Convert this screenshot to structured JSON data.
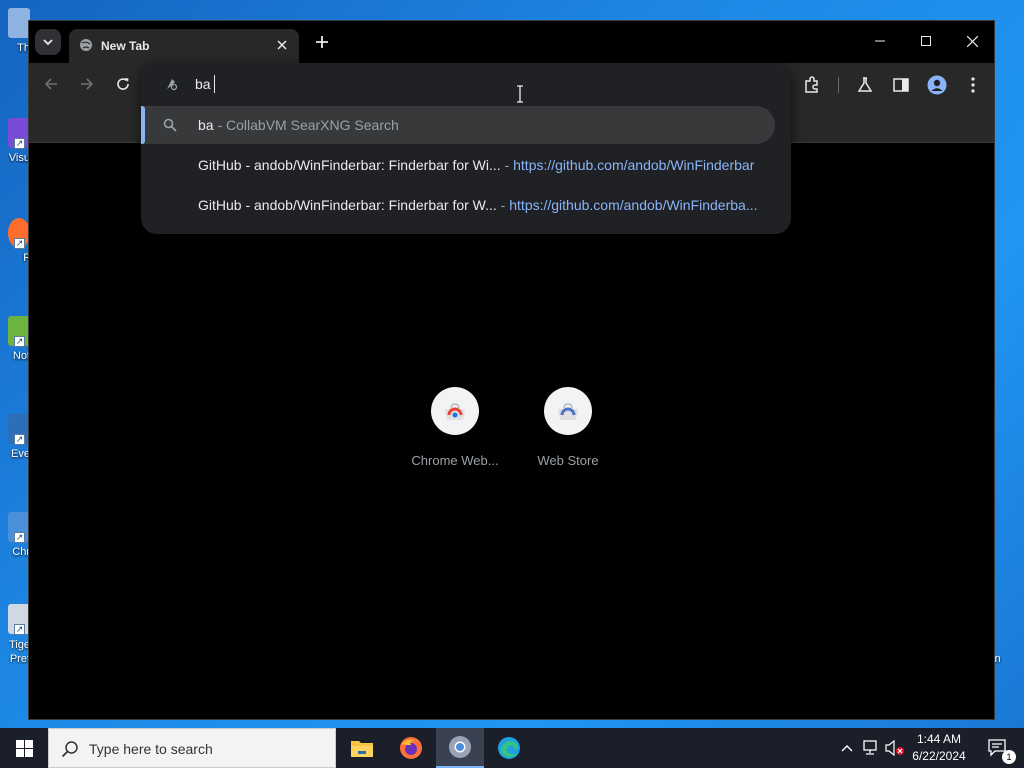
{
  "desktop": {
    "icons": [
      {
        "label": "Th",
        "color": "#8fb3e0"
      },
      {
        "label": "Visu",
        "color": "#7a4bd6"
      },
      {
        "label": "F",
        "color": "#ff6d2a"
      },
      {
        "label": "Not",
        "color": "#6db33f"
      },
      {
        "label": "Eve",
        "color": "#2c6fb7"
      },
      {
        "label": "Chr",
        "color": "#4a8fd9"
      },
      {
        "label": "Tige Pref",
        "color": "#cfd8e3"
      }
    ],
    "right_label": "in"
  },
  "browser": {
    "tab": {
      "title": "New Tab"
    },
    "omnibox": {
      "value": "ba",
      "suggestions": [
        {
          "title": "ba",
          "separator": " - ",
          "detail": "CollabVM SearXNG Search",
          "type": "search"
        },
        {
          "title": "GitHub - andob/WinFinderbar: Finderbar for Wi...",
          "separator": " - ",
          "detail": "https://github.com/andob/WinFinderbar",
          "type": "history"
        },
        {
          "title": "GitHub - andob/WinFinderbar: Finderbar for W...",
          "separator": " - ",
          "detail": "https://github.com/andob/WinFinderba...",
          "type": "history"
        }
      ]
    },
    "shortcuts": [
      {
        "label": "Chrome Web..."
      },
      {
        "label": "Web Store"
      }
    ]
  },
  "taskbar": {
    "search_placeholder": "Type here to search",
    "time": "1:44 AM",
    "date": "6/22/2024",
    "notification_count": "1"
  },
  "colors": {
    "accent": "#8ab4f8",
    "omnibox_bg": "#202124",
    "toolbar_bg": "#282828",
    "taskbar_bg": "#1b1f2a"
  }
}
